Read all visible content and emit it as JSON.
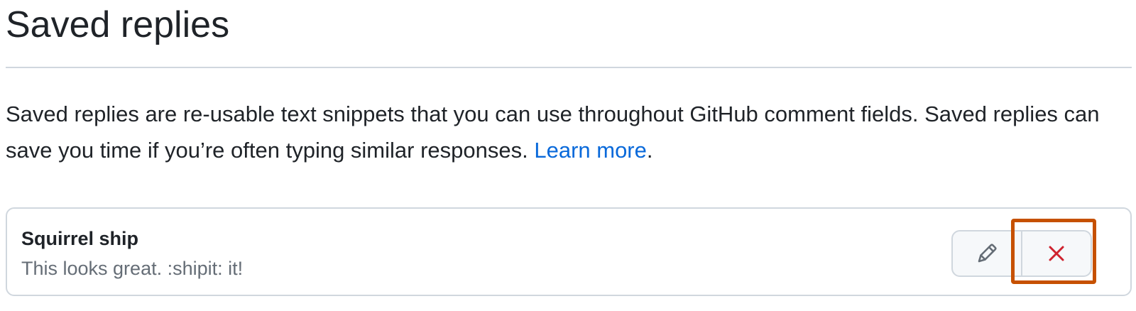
{
  "page": {
    "title": "Saved replies",
    "intro_before_link": "Saved replies are re-usable text snippets that you can use throughout GitHub comment fields. Saved replies can save you time if you’re often typing similar responses. ",
    "learn_more_label": "Learn more",
    "intro_after_link": "."
  },
  "saved_replies": [
    {
      "title": "Squirrel ship",
      "body": "This looks great. :shipit: it!",
      "actions": {
        "edit_icon": "pencil-icon",
        "delete_icon": "x-icon"
      }
    }
  ],
  "colors": {
    "text": "#1f2328",
    "muted_text": "#656d76",
    "link": "#0969da",
    "border": "#d0d7de",
    "button_background": "#f6f8fa",
    "danger": "#cf222e",
    "highlight": "#c65100"
  }
}
